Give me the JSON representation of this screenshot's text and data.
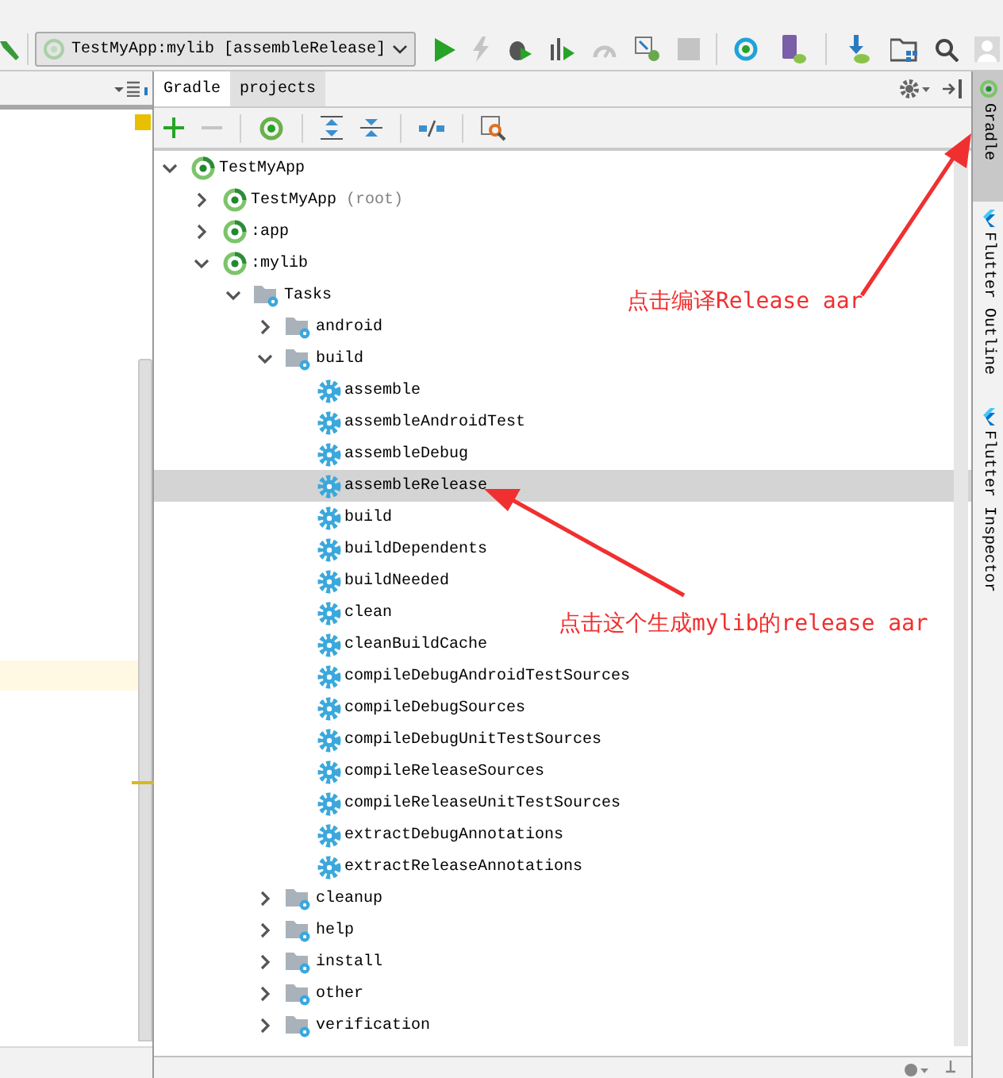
{
  "toolbar": {
    "run_config": "TestMyApp:mylib [assembleRelease]"
  },
  "gradle_panel": {
    "title": "Gradle",
    "tabs": [
      {
        "label": "projects",
        "selected": true
      }
    ],
    "tree": [
      {
        "label": "TestMyApp",
        "kind": "project",
        "expanded": true,
        "selected": false,
        "children": [
          {
            "label": "TestMyApp",
            "note": "(root)",
            "kind": "project",
            "expanded": false,
            "selected": false
          },
          {
            "label": ":app",
            "kind": "project",
            "expanded": false,
            "selected": false
          },
          {
            "label": ":mylib",
            "kind": "project",
            "expanded": true,
            "selected": false,
            "children": [
              {
                "label": "Tasks",
                "kind": "folder",
                "expanded": true,
                "selected": false,
                "children": [
                  {
                    "label": "android",
                    "kind": "folder",
                    "expanded": false,
                    "selected": false
                  },
                  {
                    "label": "build",
                    "kind": "folder",
                    "expanded": true,
                    "selected": false,
                    "children": [
                      {
                        "label": "assemble",
                        "kind": "task",
                        "selected": false
                      },
                      {
                        "label": "assembleAndroidTest",
                        "kind": "task",
                        "selected": false
                      },
                      {
                        "label": "assembleDebug",
                        "kind": "task",
                        "selected": false
                      },
                      {
                        "label": "assembleRelease",
                        "kind": "task",
                        "selected": true
                      },
                      {
                        "label": "build",
                        "kind": "task",
                        "selected": false
                      },
                      {
                        "label": "buildDependents",
                        "kind": "task",
                        "selected": false
                      },
                      {
                        "label": "buildNeeded",
                        "kind": "task",
                        "selected": false
                      },
                      {
                        "label": "clean",
                        "kind": "task",
                        "selected": false
                      },
                      {
                        "label": "cleanBuildCache",
                        "kind": "task",
                        "selected": false
                      },
                      {
                        "label": "compileDebugAndroidTestSources",
                        "kind": "task",
                        "selected": false
                      },
                      {
                        "label": "compileDebugSources",
                        "kind": "task",
                        "selected": false
                      },
                      {
                        "label": "compileDebugUnitTestSources",
                        "kind": "task",
                        "selected": false
                      },
                      {
                        "label": "compileReleaseSources",
                        "kind": "task",
                        "selected": false
                      },
                      {
                        "label": "compileReleaseUnitTestSources",
                        "kind": "task",
                        "selected": false
                      },
                      {
                        "label": "extractDebugAnnotations",
                        "kind": "task",
                        "selected": false
                      },
                      {
                        "label": "extractReleaseAnnotations",
                        "kind": "task",
                        "selected": false
                      }
                    ]
                  },
                  {
                    "label": "cleanup",
                    "kind": "folder",
                    "expanded": false,
                    "selected": false
                  },
                  {
                    "label": "help",
                    "kind": "folder",
                    "expanded": false,
                    "selected": false
                  },
                  {
                    "label": "install",
                    "kind": "folder",
                    "expanded": false,
                    "selected": false
                  },
                  {
                    "label": "other",
                    "kind": "folder",
                    "expanded": false,
                    "selected": false
                  },
                  {
                    "label": "verification",
                    "kind": "folder",
                    "expanded": false,
                    "selected": false
                  }
                ]
              }
            ]
          }
        ]
      }
    ]
  },
  "side_tabs": [
    {
      "label": "Gradle",
      "kind": "gradle",
      "selected": true
    },
    {
      "label": "Flutter Outline",
      "kind": "flutter",
      "selected": false
    },
    {
      "label": "Flutter Inspector",
      "kind": "flutter",
      "selected": false
    }
  ],
  "annotations": [
    {
      "text": "点击编译Release aar"
    },
    {
      "text": "点击这个生成mylib的release aar"
    }
  ]
}
